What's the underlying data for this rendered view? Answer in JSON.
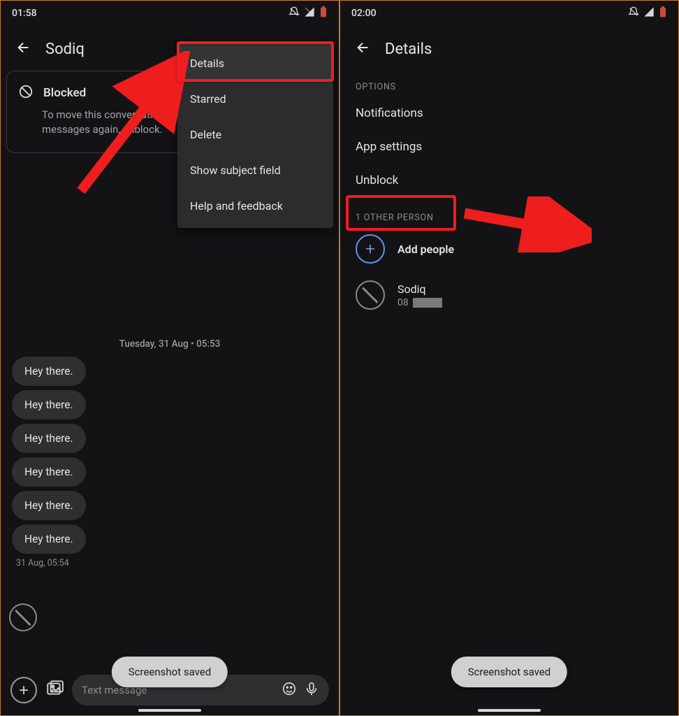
{
  "left": {
    "status": {
      "time": "01:58"
    },
    "appbar": {
      "title": "Sodiq"
    },
    "blocked": {
      "title": "Blocked",
      "body": "To move this conversation out of 'Spam & blocked' and get messages again, unblock."
    },
    "menu": {
      "items": [
        "Details",
        "Starred",
        "Delete",
        "Show subject field",
        "Help and feedback"
      ]
    },
    "timestamp": "Tuesday, 31 Aug • 05:53",
    "messages": [
      "Hey there.",
      "Hey there.",
      "Hey there.",
      "Hey there.",
      "Hey there.",
      "Hey there."
    ],
    "msg_meta": "31 Aug, 05:54",
    "composer": {
      "placeholder": "Text message"
    },
    "toast": "Screenshot saved"
  },
  "right": {
    "status": {
      "time": "02:00"
    },
    "appbar": {
      "title": "Details"
    },
    "sections": {
      "options_label": "OPTIONS",
      "options": [
        "Notifications",
        "App settings",
        "Unblock"
      ],
      "people_label": "1 OTHER PERSON",
      "add_people": "Add people",
      "person": {
        "name": "Sodiq",
        "number_prefix": "08"
      }
    },
    "toast": "Screenshot saved"
  },
  "colors": {
    "highlight": "#ef1e1e",
    "accent": "#6b8fe8"
  }
}
